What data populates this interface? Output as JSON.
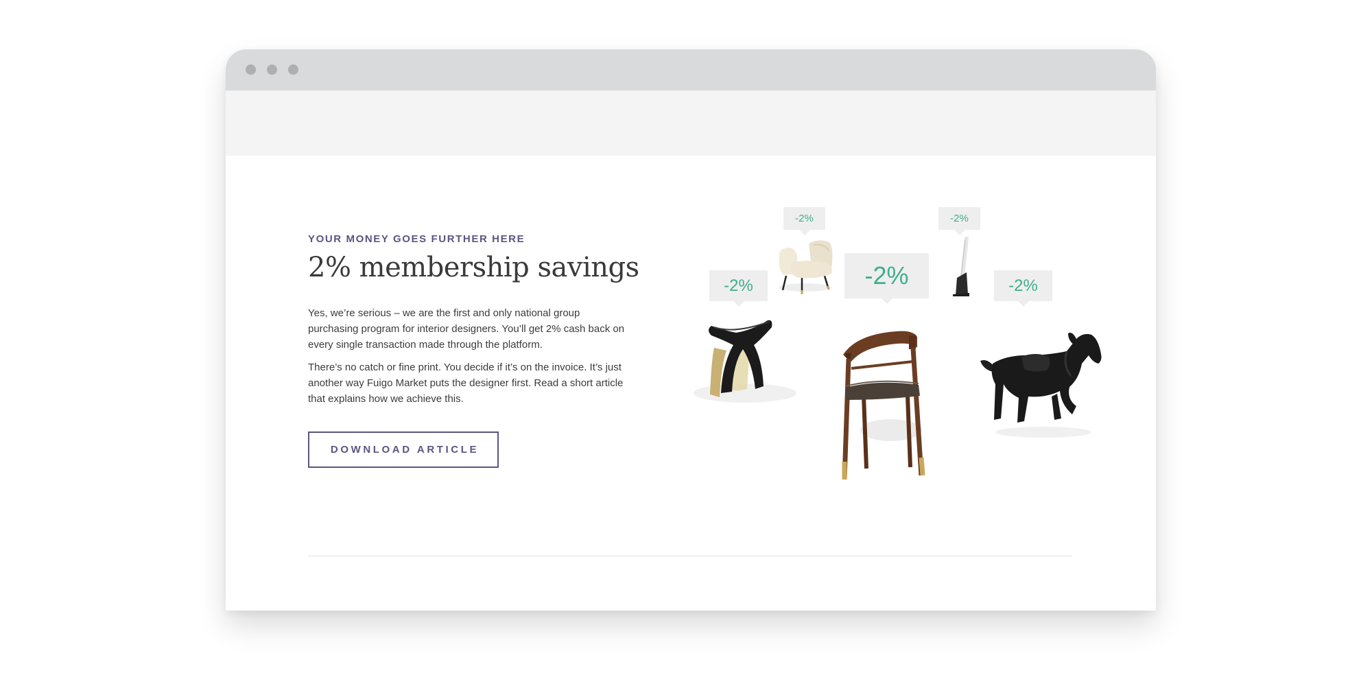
{
  "content": {
    "eyebrow": "YOUR MONEY GOES FURTHER HERE",
    "headline": "2% membership savings",
    "paragraph1": "Yes, we’re serious – we are the first and only national group purchasing program for interior designers. You’ll get 2% cash back on every single transaction made through the platform.",
    "paragraph2": "There’s no catch or fine print. You decide if it’s on the invoice. It’s just another way Fuigo Market puts the designer first. Read a short article that explains how we achieve this.",
    "download_label": "DOWNLOAD ARTICLE"
  },
  "gallery": {
    "tags": {
      "armchair": "-2%",
      "lamp": "-2%",
      "stool": "-2%",
      "chair": "-2%",
      "horse": "-2%"
    },
    "accent_color": "#3fae8c",
    "brand_color": "#5a5580"
  }
}
